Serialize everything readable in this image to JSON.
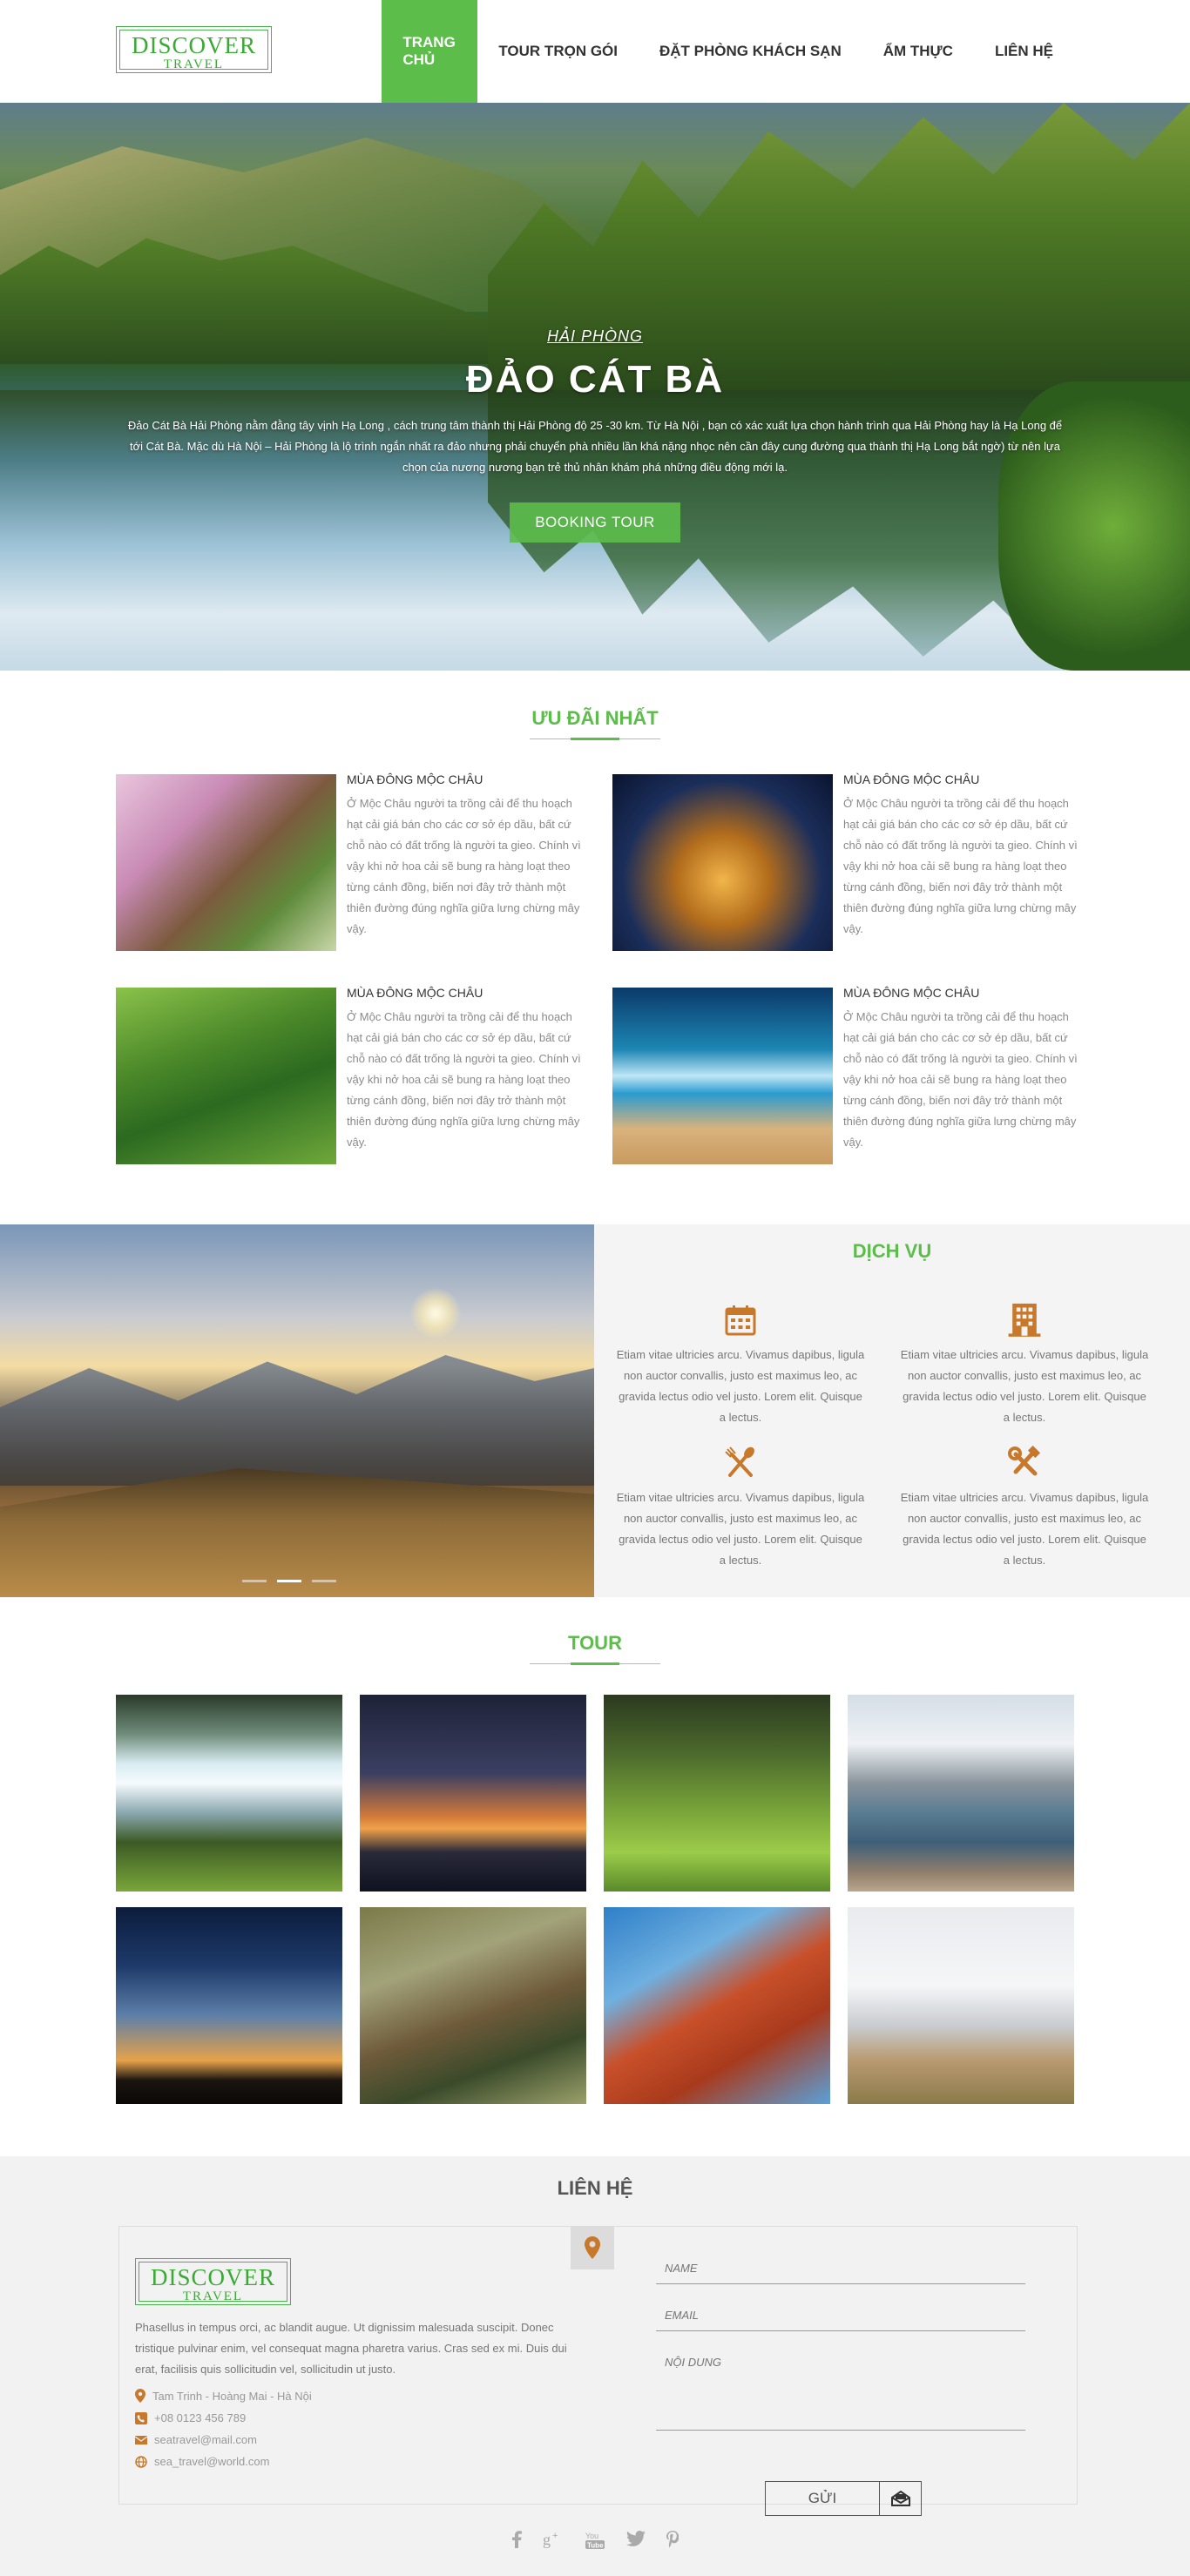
{
  "logo": {
    "top": "DISCOVER",
    "bottom": "TRAVEL"
  },
  "nav": [
    {
      "label": "TRANG CHỦ",
      "active": true
    },
    {
      "label": "TOUR TRỌN GÓI"
    },
    {
      "label": "ĐẶT PHÒNG KHÁCH SẠN"
    },
    {
      "label": "ẨM THỰC"
    },
    {
      "label": "LIÊN HỆ"
    }
  ],
  "hero": {
    "subtitle": "HẢI PHÒNG",
    "title": "ĐẢO CÁT BÀ",
    "text": "Đảo Cát Bà Hải Phòng nằm đằng tây vịnh Hạ Long , cách trung tâm thành thị Hải Phòng độ 25 -30 km. Từ Hà Nội , bạn có xác xuất lựa chọn hành trình qua Hải Phòng hay là Hạ Long để tới Cát Bà. Mặc dù Hà Nội – Hải Phòng là lộ trình ngắn nhất ra đảo nhưng phải chuyển phà nhiều lần khá nặng nhọc nên cần đây cung đường qua thành thị Hạ Long bắt ngờ) từ nên lựa chọn của nương nương bạn trẻ thủ nhân khám phá những điều động mới lạ.",
    "button": "BOOKING TOUR"
  },
  "offers": {
    "title": "ƯU ĐÃI NHẤT",
    "items": [
      {
        "title": "MÙA ĐÔNG MỘC CHÂU",
        "text": "Ở Mộc Châu người ta trồng cải để thu hoạch hạt cải giá bán cho các cơ sở ép dầu, bất cứ chỗ nào có đất trống là người ta gieo. Chính vì vậy khi nở hoa cải sẽ bung ra hàng loạt theo từng cánh đồng, biến nơi đây trở thành một thiên đường đúng nghĩa giữa lưng chừng mây vậy."
      },
      {
        "title": "MÙA ĐÔNG MỘC CHÂU",
        "text": "Ở Mộc Châu người ta trồng cải để thu hoạch hạt cải giá bán cho các cơ sở ép dầu, bất cứ chỗ nào có đất trống là người ta gieo. Chính vì vậy khi nở hoa cải sẽ bung ra hàng loạt theo từng cánh đồng, biến nơi đây trở thành một thiên đường đúng nghĩa giữa lưng chừng mây vậy."
      },
      {
        "title": "MÙA ĐÔNG MỘC CHÂU",
        "text": "Ở Mộc Châu người ta trồng cải để thu hoạch hạt cải giá bán cho các cơ sở ép dầu, bất cứ chỗ nào có đất trống là người ta gieo. Chính vì vậy khi nở hoa cải sẽ bung ra hàng loạt theo từng cánh đồng, biến nơi đây trở thành một thiên đường đúng nghĩa giữa lưng chừng mây vậy."
      },
      {
        "title": "MÙA ĐÔNG MỘC CHÂU",
        "text": "Ở Mộc Châu người ta trồng cải để thu hoạch hạt cải giá bán cho các cơ sở ép dầu, bất cứ chỗ nào có đất trống là người ta gieo. Chính vì vậy khi nở hoa cải sẽ bung ra hàng loạt theo từng cánh đồng, biến nơi đây trở thành một thiên đường đúng nghĩa giữa lưng chừng mây vậy."
      }
    ]
  },
  "services": {
    "title": "DỊCH VỤ",
    "items": [
      {
        "icon": "calendar-icon",
        "text": "Etiam vitae ultricies arcu. Vivamus dapibus, ligula non auctor convallis, justo est maximus leo, ac gravida lectus odio vel justo. Lorem elit. Quisque a lectus."
      },
      {
        "icon": "building-icon",
        "text": "Etiam vitae ultricies arcu. Vivamus dapibus, ligula non auctor convallis, justo est maximus leo, ac gravida lectus odio vel justo. Lorem elit. Quisque a lectus."
      },
      {
        "icon": "cutlery-icon",
        "text": "Etiam vitae ultricies arcu. Vivamus dapibus, ligula non auctor convallis, justo est maximus leo, ac gravida lectus odio vel justo. Lorem elit. Quisque a lectus."
      },
      {
        "icon": "tools-icon",
        "text": "Etiam vitae ultricies arcu. Vivamus dapibus, ligula non auctor convallis, justo est maximus leo, ac gravida lectus odio vel justo. Lorem elit. Quisque a lectus."
      }
    ]
  },
  "tour": {
    "title": "TOUR"
  },
  "contact": {
    "title": "LIÊN HỆ",
    "description": "Phasellus in tempus orci, ac blandit augue. Ut dignissim malesuada suscipit. Donec tristique pulvinar enim, vel consequat magna pharetra varius. Cras sed ex mi. Duis dui erat, facilisis quis sollicitudin vel, sollicitudin ut justo.",
    "address": "Tam Trinh - Hoàng Mai - Hà Nội",
    "phone": "+08 0123 456 789",
    "email": "seatravel@mail.com",
    "website": "sea_travel@world.com",
    "form": {
      "name_placeholder": "NAME",
      "email_placeholder": "EMAIL",
      "content_placeholder": "NỘI DUNG",
      "send_label": "GỬI"
    }
  },
  "colors": {
    "accent": "#5cbd4b",
    "icon": "#c8782a"
  }
}
